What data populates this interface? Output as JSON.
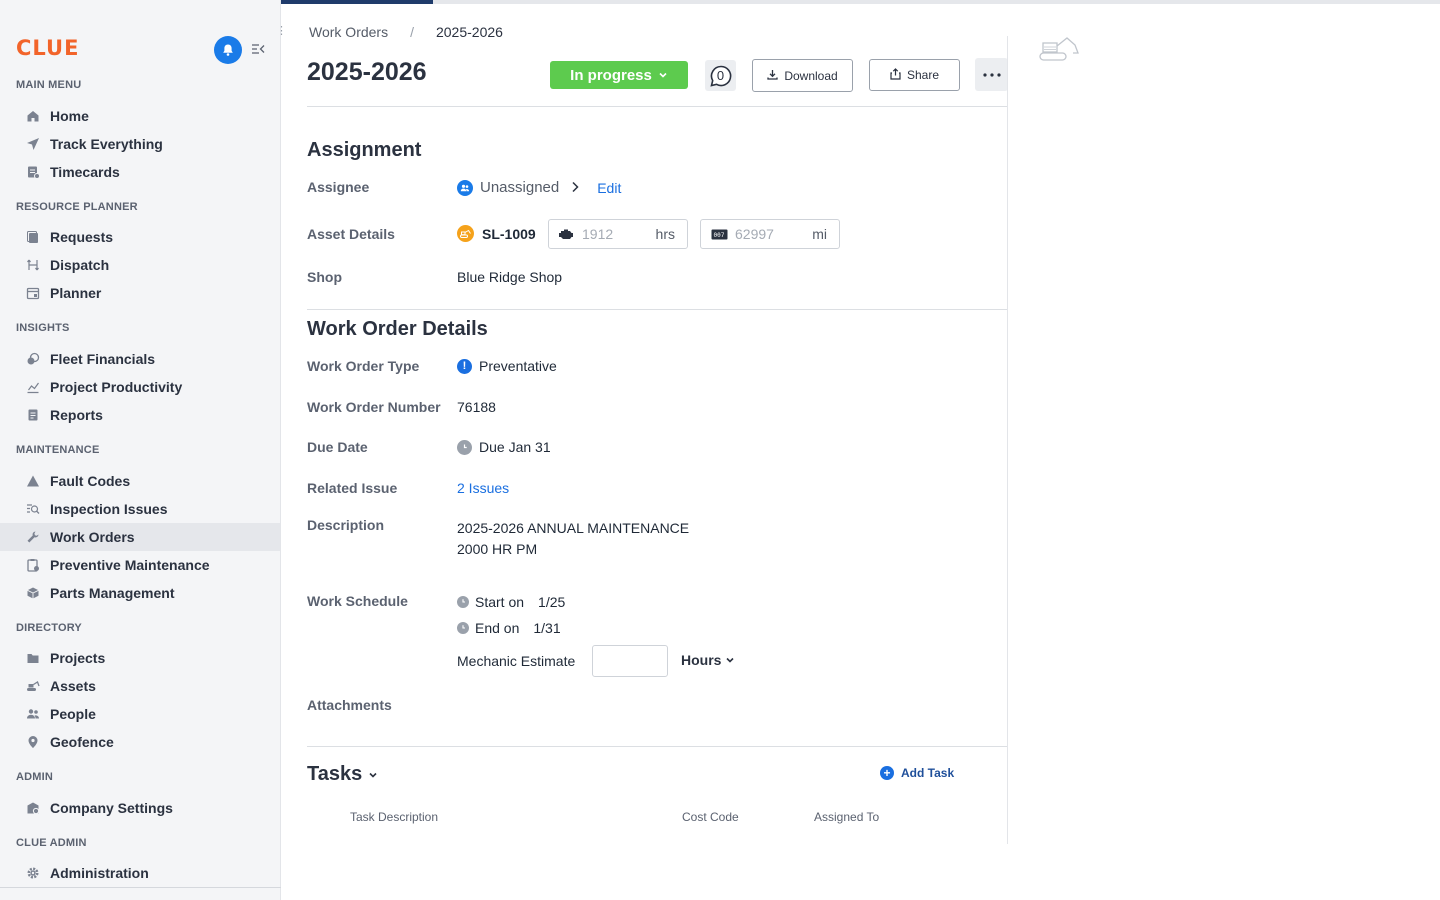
{
  "app": {
    "logo": "CLUE",
    "colors": {
      "brand": "#f2642a",
      "accent": "#1a7be8",
      "status_green": "#5dcb4e",
      "link": "#1a6fe0"
    }
  },
  "sidebar": {
    "sections": [
      {
        "label": "MAIN MENU",
        "items": [
          {
            "label": "Home",
            "icon": "home-icon"
          },
          {
            "label": "Track Everything",
            "icon": "navigation-arrow-icon"
          },
          {
            "label": "Timecards",
            "icon": "timecard-icon"
          }
        ]
      },
      {
        "label": "RESOURCE PLANNER",
        "items": [
          {
            "label": "Requests",
            "icon": "requests-icon"
          },
          {
            "label": "Dispatch",
            "icon": "dispatch-icon"
          },
          {
            "label": "Planner",
            "icon": "calendar-icon"
          }
        ]
      },
      {
        "label": "INSIGHTS",
        "items": [
          {
            "label": "Fleet Financials",
            "icon": "coins-icon"
          },
          {
            "label": "Project Productivity",
            "icon": "chart-icon"
          },
          {
            "label": "Reports",
            "icon": "report-icon"
          }
        ]
      },
      {
        "label": "MAINTENANCE",
        "items": [
          {
            "label": "Fault Codes",
            "icon": "warning-triangle-icon"
          },
          {
            "label": "Inspection Issues",
            "icon": "inspection-icon"
          },
          {
            "label": "Work Orders",
            "icon": "wrench-icon",
            "active": true
          },
          {
            "label": "Preventive Maintenance",
            "icon": "clipboard-icon"
          },
          {
            "label": "Parts Management",
            "icon": "box-icon"
          }
        ]
      },
      {
        "label": "DIRECTORY",
        "items": [
          {
            "label": "Projects",
            "icon": "folder-icon"
          },
          {
            "label": "Assets",
            "icon": "excavator-icon"
          },
          {
            "label": "People",
            "icon": "people-icon"
          },
          {
            "label": "Geofence",
            "icon": "location-pin-icon"
          }
        ]
      },
      {
        "label": "ADMIN",
        "items": [
          {
            "label": "Company Settings",
            "icon": "building-settings-icon"
          }
        ]
      },
      {
        "label": "CLUE ADMIN",
        "items": [
          {
            "label": "Administration",
            "icon": "gear-icon"
          }
        ]
      }
    ]
  },
  "header": {
    "breadcrumb": {
      "parent": "Work Orders",
      "separator": "/",
      "current": "2025-2026"
    },
    "title": "2025-2026",
    "status": "In progress",
    "comment_count": "0",
    "download_label": "Download",
    "share_label": "Share"
  },
  "assignment": {
    "heading": "Assignment",
    "assignee_label": "Assignee",
    "assignee_value": "Unassigned",
    "edit_label": "Edit",
    "asset_label": "Asset Details",
    "asset_id": "SL-1009",
    "hours_placeholder": "1912",
    "hours_unit": "hrs",
    "miles_placeholder": "62997",
    "miles_unit": "mi",
    "shop_label": "Shop",
    "shop_value": "Blue Ridge Shop"
  },
  "details": {
    "heading": "Work Order Details",
    "type_label": "Work Order Type",
    "type_value": "Preventative",
    "number_label": "Work Order Number",
    "number_value": "76188",
    "due_label": "Due Date",
    "due_value": "Due Jan 31",
    "issue_label": "Related Issue",
    "issue_value": "2 Issues",
    "description_label": "Description",
    "description_line1": "2025-2026 ANNUAL MAINTENANCE",
    "description_line2": "2000 HR PM",
    "schedule_label": "Work Schedule",
    "start_label": "Start on",
    "start_date": "1/25",
    "end_label": "End on",
    "end_date": "1/31",
    "estimate_label": "Mechanic Estimate",
    "estimate_value": "",
    "estimate_unit": "Hours",
    "attachments_label": "Attachments"
  },
  "tasks": {
    "heading": "Tasks",
    "add_label": "Add Task",
    "columns": [
      "Task Description",
      "Cost Code",
      "Assigned To"
    ]
  }
}
